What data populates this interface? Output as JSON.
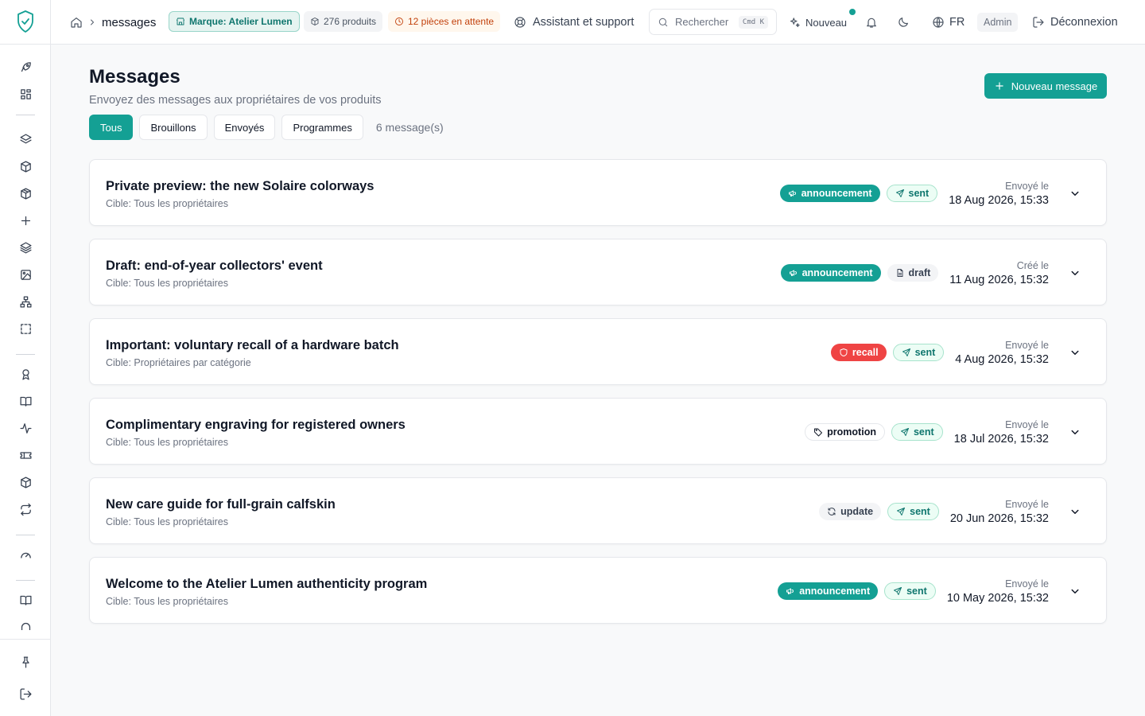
{
  "breadcrumb": {
    "current": "messages"
  },
  "topbar": {
    "brand_pill": "Marque: Atelier Lumen",
    "products_pill": "276 produits",
    "pending_pill": "12 pièces en attente",
    "support": "Assistant et support",
    "search_placeholder": "Rechercher",
    "search_shortcut": "Cmd K",
    "new_label": "Nouveau",
    "language": "FR",
    "role": "Admin",
    "logout": "Déconnexion"
  },
  "page": {
    "title": "Messages",
    "subtitle": "Envoyez des messages aux propriétaires de vos produits",
    "new_button": "Nouveau message",
    "count": "6 message(s)"
  },
  "tabs": [
    {
      "label": "Tous",
      "active": true
    },
    {
      "label": "Brouillons",
      "active": false
    },
    {
      "label": "Envoyés",
      "active": false
    },
    {
      "label": "Programmes",
      "active": false
    }
  ],
  "messages": [
    {
      "title": "Private preview: the new Solaire colorways",
      "target": "Cible: Tous les propriétaires",
      "type": "announcement",
      "type_icon": "megaphone-icon",
      "status": "sent",
      "status_icon": "send-icon",
      "date_label": "Envoyé le",
      "date": "18 Aug 2026, 15:33"
    },
    {
      "title": "Draft: end-of-year collectors' event",
      "target": "Cible: Tous les propriétaires",
      "type": "announcement",
      "type_icon": "megaphone-icon",
      "status": "draft",
      "status_icon": "file-icon",
      "date_label": "Créé le",
      "date": "11 Aug 2026, 15:32"
    },
    {
      "title": "Important: voluntary recall of a hardware batch",
      "target": "Cible: Propriétaires par catégorie",
      "type": "recall",
      "type_icon": "shield-icon",
      "status": "sent",
      "status_icon": "send-icon",
      "date_label": "Envoyé le",
      "date": "4 Aug 2026, 15:32"
    },
    {
      "title": "Complimentary engraving for registered owners",
      "target": "Cible: Tous les propriétaires",
      "type": "promotion",
      "type_icon": "tag-icon",
      "status": "sent",
      "status_icon": "send-icon",
      "date_label": "Envoyé le",
      "date": "18 Jul 2026, 15:32"
    },
    {
      "title": "New care guide for full-grain calfskin",
      "target": "Cible: Tous les propriétaires",
      "type": "update",
      "type_icon": "refresh-icon",
      "status": "sent",
      "status_icon": "send-icon",
      "date_label": "Envoyé le",
      "date": "20 Jun 2026, 15:32"
    },
    {
      "title": "Welcome to the Atelier Lumen authenticity program",
      "target": "Cible: Tous les propriétaires",
      "type": "announcement",
      "type_icon": "megaphone-icon",
      "status": "sent",
      "status_icon": "send-icon",
      "date_label": "Envoyé le",
      "date": "10 May 2026, 15:32"
    }
  ],
  "colors": {
    "accent": "#14a094",
    "recall": "#ef4444",
    "pending": "#c2410c"
  }
}
